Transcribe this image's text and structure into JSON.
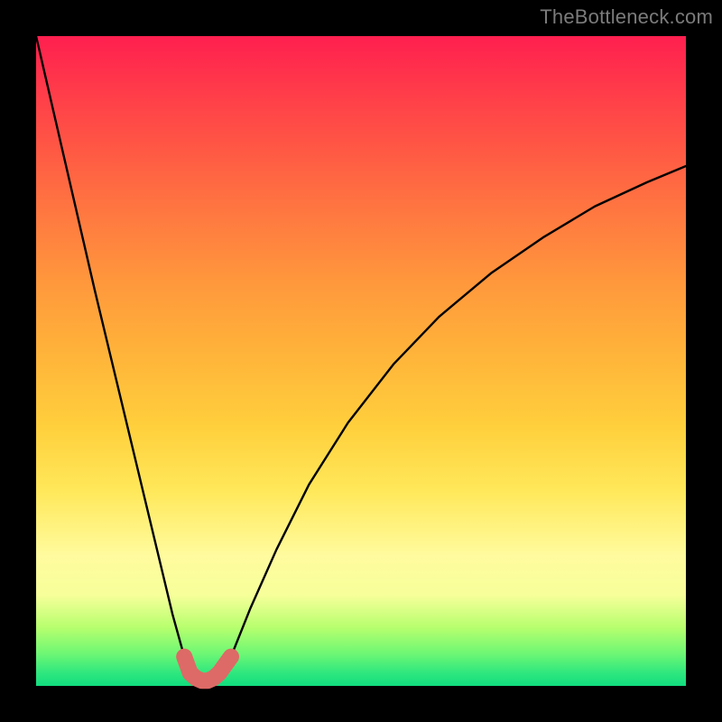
{
  "watermark": {
    "text": "TheBottleneck.com"
  },
  "colors": {
    "page_bg": "#000000",
    "curve_main": "#000000",
    "curve_highlight": "#dd6a66",
    "watermark": "#7b7b7b"
  },
  "chart_data": {
    "type": "line",
    "title": "",
    "xlabel": "",
    "ylabel": "",
    "xlim": [
      0,
      1
    ],
    "ylim": [
      0,
      1
    ],
    "series": [
      {
        "name": "bottleneck-curve",
        "x": [
          0.0,
          0.03,
          0.06,
          0.09,
          0.12,
          0.15,
          0.18,
          0.21,
          0.228,
          0.246,
          0.264,
          0.282,
          0.3,
          0.33,
          0.37,
          0.42,
          0.48,
          0.55,
          0.62,
          0.7,
          0.78,
          0.86,
          0.94,
          1.0
        ],
        "y": [
          1.0,
          0.87,
          0.74,
          0.61,
          0.485,
          0.36,
          0.235,
          0.11,
          0.045,
          0.012,
          0.008,
          0.012,
          0.045,
          0.12,
          0.21,
          0.31,
          0.405,
          0.495,
          0.568,
          0.635,
          0.69,
          0.738,
          0.775,
          0.8
        ]
      },
      {
        "name": "bottleneck-minimum-highlight",
        "x": [
          0.228,
          0.237,
          0.246,
          0.255,
          0.264,
          0.273,
          0.282,
          0.3
        ],
        "y": [
          0.045,
          0.02,
          0.012,
          0.008,
          0.008,
          0.012,
          0.02,
          0.045
        ]
      }
    ],
    "gradient_stops": [
      {
        "pos": 0.0,
        "color": "#ff1f4f"
      },
      {
        "pos": 0.38,
        "color": "#ff983c"
      },
      {
        "pos": 0.7,
        "color": "#ffe85a"
      },
      {
        "pos": 0.86,
        "color": "#f7ff9a"
      },
      {
        "pos": 1.0,
        "color": "#11dd7f"
      }
    ]
  }
}
